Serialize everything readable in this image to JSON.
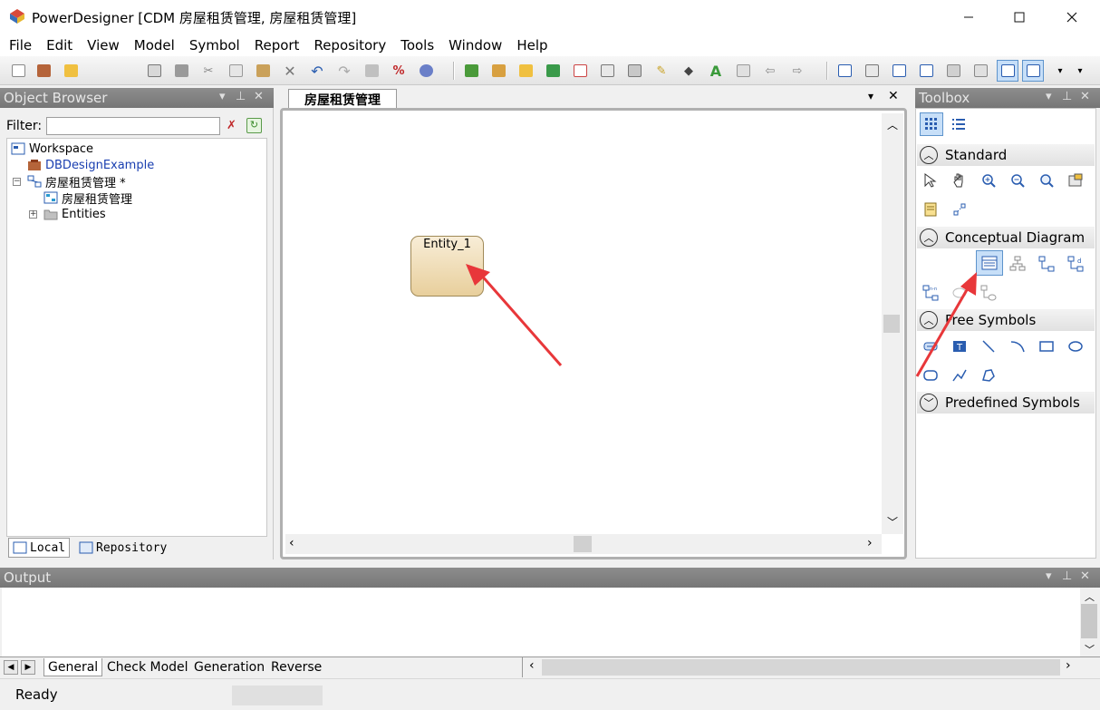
{
  "window": {
    "title": "PowerDesigner [CDM 房屋租赁管理, 房屋租赁管理]",
    "minimize": "—",
    "maximize": "☐",
    "close": "✕"
  },
  "menu": [
    {
      "label": "File"
    },
    {
      "label": "Edit"
    },
    {
      "label": "View"
    },
    {
      "label": "Model"
    },
    {
      "label": "Symbol"
    },
    {
      "label": "Report"
    },
    {
      "label": "Repository"
    },
    {
      "label": "Tools"
    },
    {
      "label": "Window"
    },
    {
      "label": "Help"
    }
  ],
  "object_browser": {
    "title": "Object Browser",
    "filter_label": "Filter:",
    "filter_value": "",
    "tree": {
      "workspace": "Workspace",
      "db_example": "DBDesignExample",
      "model": "房屋租赁管理 *",
      "diagram": "房屋租赁管理",
      "entities": "Entities"
    },
    "tabs": {
      "local": "Local",
      "repository": "Repository"
    }
  },
  "diagram": {
    "tab_title": "房屋租赁管理",
    "entity_name": "Entity_1"
  },
  "toolbox": {
    "title": "Toolbox",
    "sections": {
      "standard": "Standard",
      "conceptual": "Conceptual Diagram",
      "free": "Free Symbols",
      "predefined": "Predefined Symbols"
    },
    "selected_tool_icon": "entity-tool-icon"
  },
  "output": {
    "title": "Output",
    "tabs": [
      "General",
      "Check Model",
      "Generation",
      "Reverse"
    ]
  },
  "status": {
    "text": "Ready"
  },
  "colors": {
    "panel_header": "#808080",
    "selection": "#c7dff8",
    "annotation_arrow": "#e8373a",
    "entity_fill": "#f0dcb2"
  }
}
